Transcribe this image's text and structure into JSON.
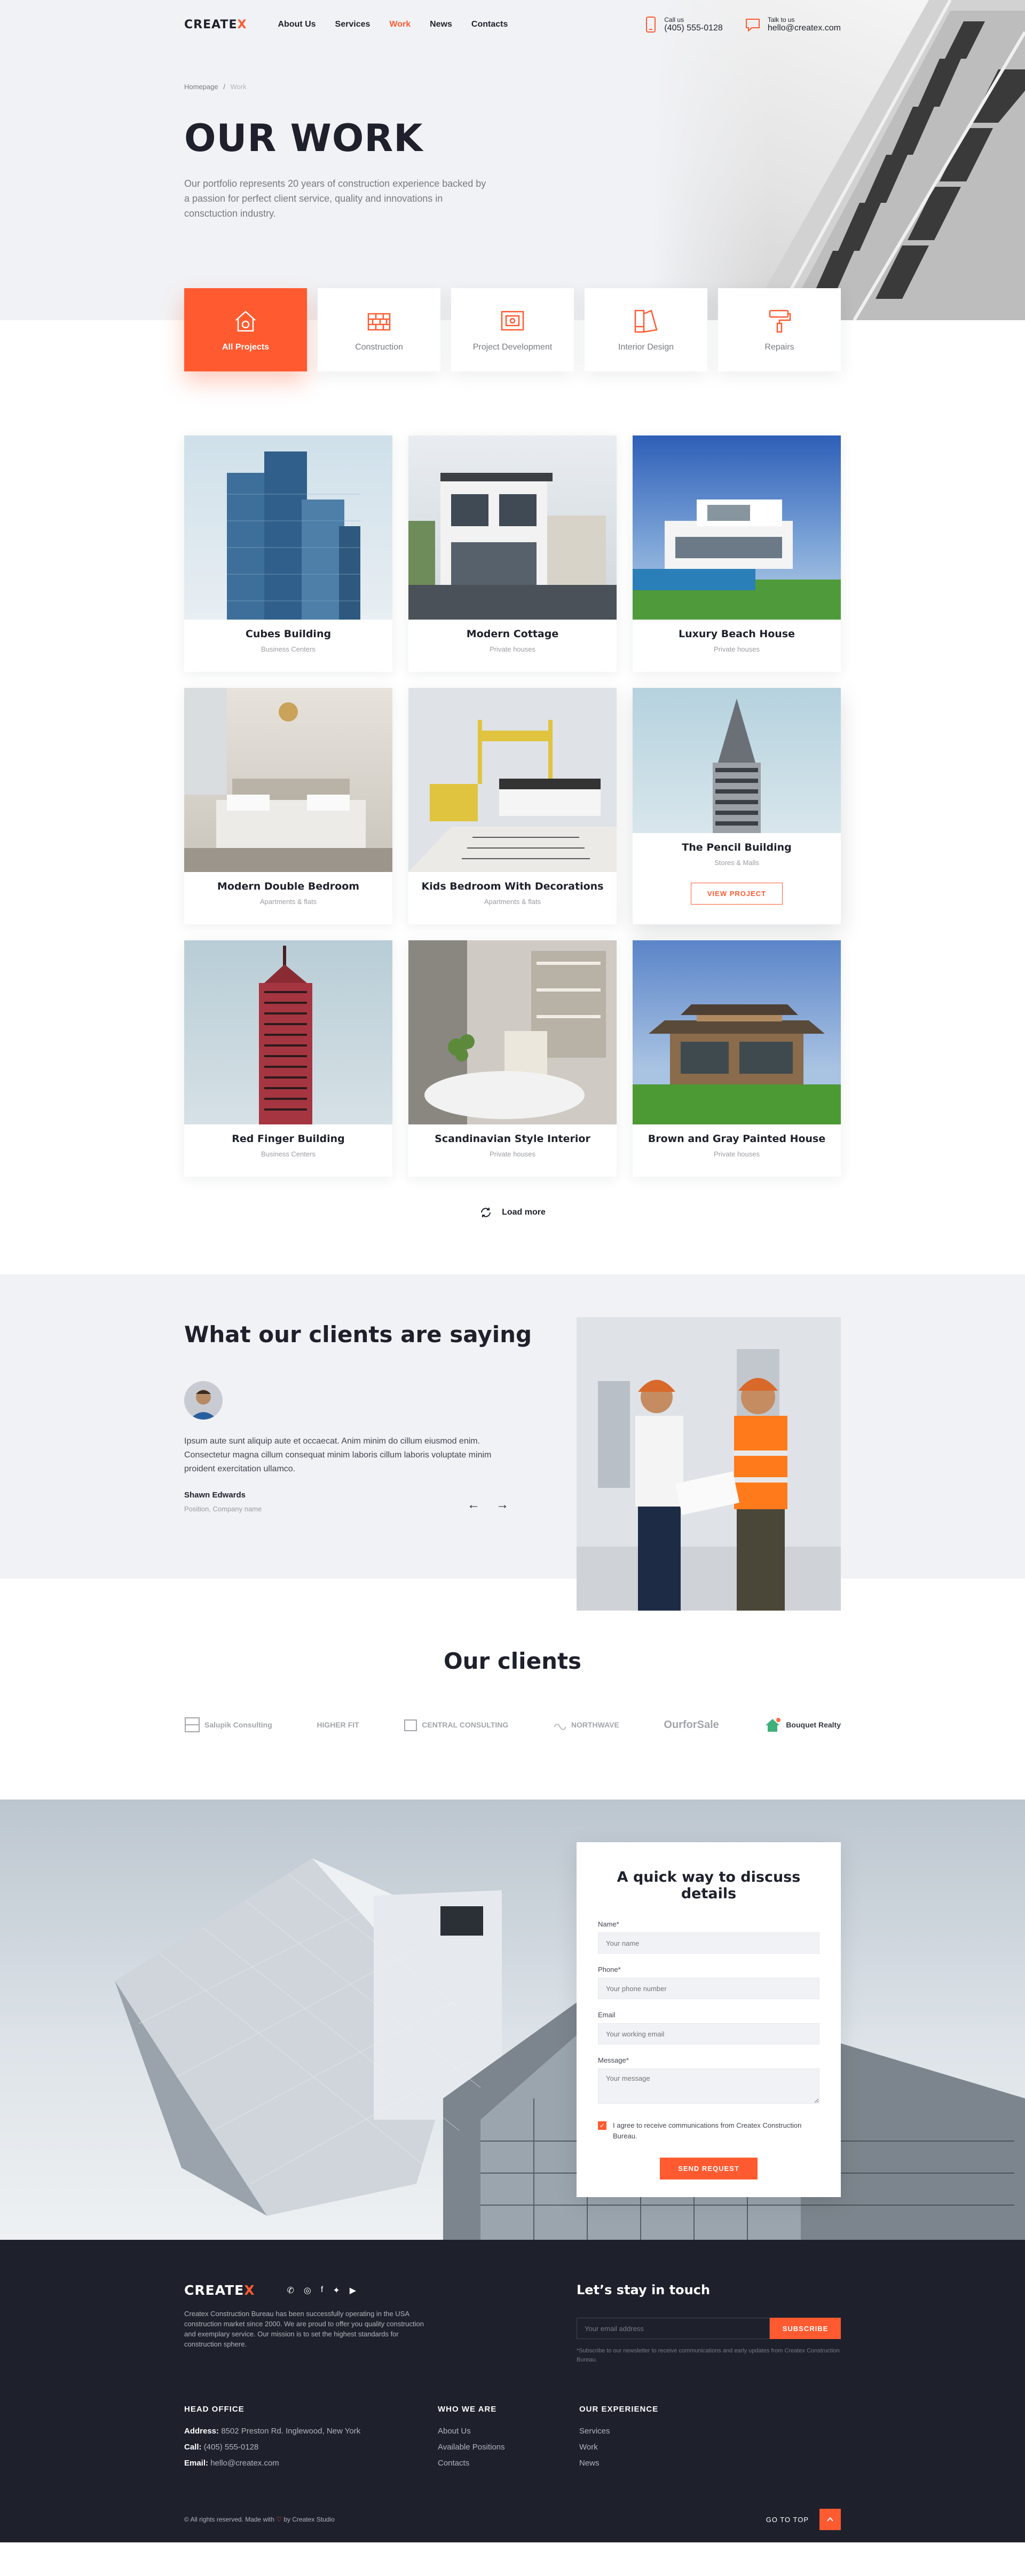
{
  "header": {
    "logo": "CREATE",
    "logo_x": "X",
    "nav": [
      "About Us",
      "Services",
      "Work",
      "News",
      "Contacts"
    ],
    "call_label": "Call us",
    "phone": "(405) 555-0128",
    "talk_label": "Talk to us",
    "email": "hello@createx.com"
  },
  "hero": {
    "breadcrumb_home": "Homepage",
    "breadcrumb_sep": "/",
    "breadcrumb_current": "Work",
    "title": "OUR WORK",
    "description": "Our portfolio represents 20 years of construction experience backed by a passion for perfect client service, quality and innovations in consctuction industry."
  },
  "categories": [
    {
      "label": "All Projects",
      "icon": "house-icon"
    },
    {
      "label": "Construction",
      "icon": "bricks-icon"
    },
    {
      "label": "Project Development",
      "icon": "blueprint-icon"
    },
    {
      "label": "Interior Design",
      "icon": "palette-icon"
    },
    {
      "label": "Repairs",
      "icon": "paint-roller-icon"
    }
  ],
  "projects": [
    {
      "title": "Cubes Building",
      "category": "Business Centers"
    },
    {
      "title": "Modern Cottage",
      "category": "Private houses"
    },
    {
      "title": "Luxury Beach House",
      "category": "Private houses"
    },
    {
      "title": "Modern Double Bedroom",
      "category": "Apartments & flats"
    },
    {
      "title": "Kids Bedroom With Decorations",
      "category": "Apartments & flats"
    },
    {
      "title": "The Pencil Building",
      "category": "Stores & Malls",
      "button": "VIEW PROJECT"
    },
    {
      "title": "Red Finger Building",
      "category": "Business Centers"
    },
    {
      "title": "Scandinavian Style Interior",
      "category": "Private houses"
    },
    {
      "title": "Brown and Gray Painted House",
      "category": "Private houses"
    }
  ],
  "load_more": "Load more",
  "testimonial": {
    "heading": "What our clients are saying",
    "quote": "Ipsum aute sunt aliquip aute et occaecat. Anim minim do cillum eiusmod enim. Consectetur magna cillum consequat minim laboris cillum laboris voluptate minim proident exercitation ullamco.",
    "name": "Shawn Edwards",
    "position": "Position, Company name",
    "prev": "←",
    "next": "→"
  },
  "clients": {
    "heading": "Our clients",
    "logos": [
      "Salupik Consulting",
      "HIGHER FIT",
      "CENTRAL CONSULTING",
      "NORTHWAVE",
      "OurforSale",
      "Bouquet Realty"
    ]
  },
  "form": {
    "heading": "A quick way to discuss details",
    "name_label": "Name*",
    "name_placeholder": "Your name",
    "phone_label": "Phone*",
    "phone_placeholder": "Your phone number",
    "email_label": "Email",
    "email_placeholder": "Your working email",
    "message_label": "Message*",
    "message_placeholder": "Your message",
    "consent": "I agree to receive communications from Createx Construction Bureau.",
    "submit": "SEND REQUEST"
  },
  "footer": {
    "logo": "CREATE",
    "logo_x": "X",
    "about": "Createx Construction Bureau has been successfully operating in the USA construction market since 2000. We are proud to offer you quality construction and exemplary service. Our mission is to set the highest standards for construction sphere.",
    "stay_heading": "Let’s stay in touch",
    "subscribe_placeholder": "Your email address",
    "subscribe_button": "SUBSCRIBE",
    "subscribe_note": "*Subscribe to our newsletter to receive communications and early updates from Createx Construction Bureau.",
    "head_office_title": "HEAD OFFICE",
    "address_label": "Address:",
    "address": "8502 Preston Rd. Inglewood, New York",
    "call_label": "Call:",
    "phone": "(405) 555-0128",
    "email_label": "Email:",
    "email": "hello@createx.com",
    "who_title": "WHO WE ARE",
    "who_links": [
      "About Us",
      "Available Positions",
      "Contacts"
    ],
    "exp_title": "OUR EXPERIENCE",
    "exp_links": [
      "Services",
      "Work",
      "News"
    ],
    "copyright_pre": "© All rights reserved. Made with",
    "copyright_post": "by Createx Studio",
    "go_top": "GO TO TOP"
  },
  "colors": {
    "accent": "#ff5a30",
    "dark": "#1e212c",
    "gray": "#787a80",
    "light": "#f1f2f5"
  }
}
